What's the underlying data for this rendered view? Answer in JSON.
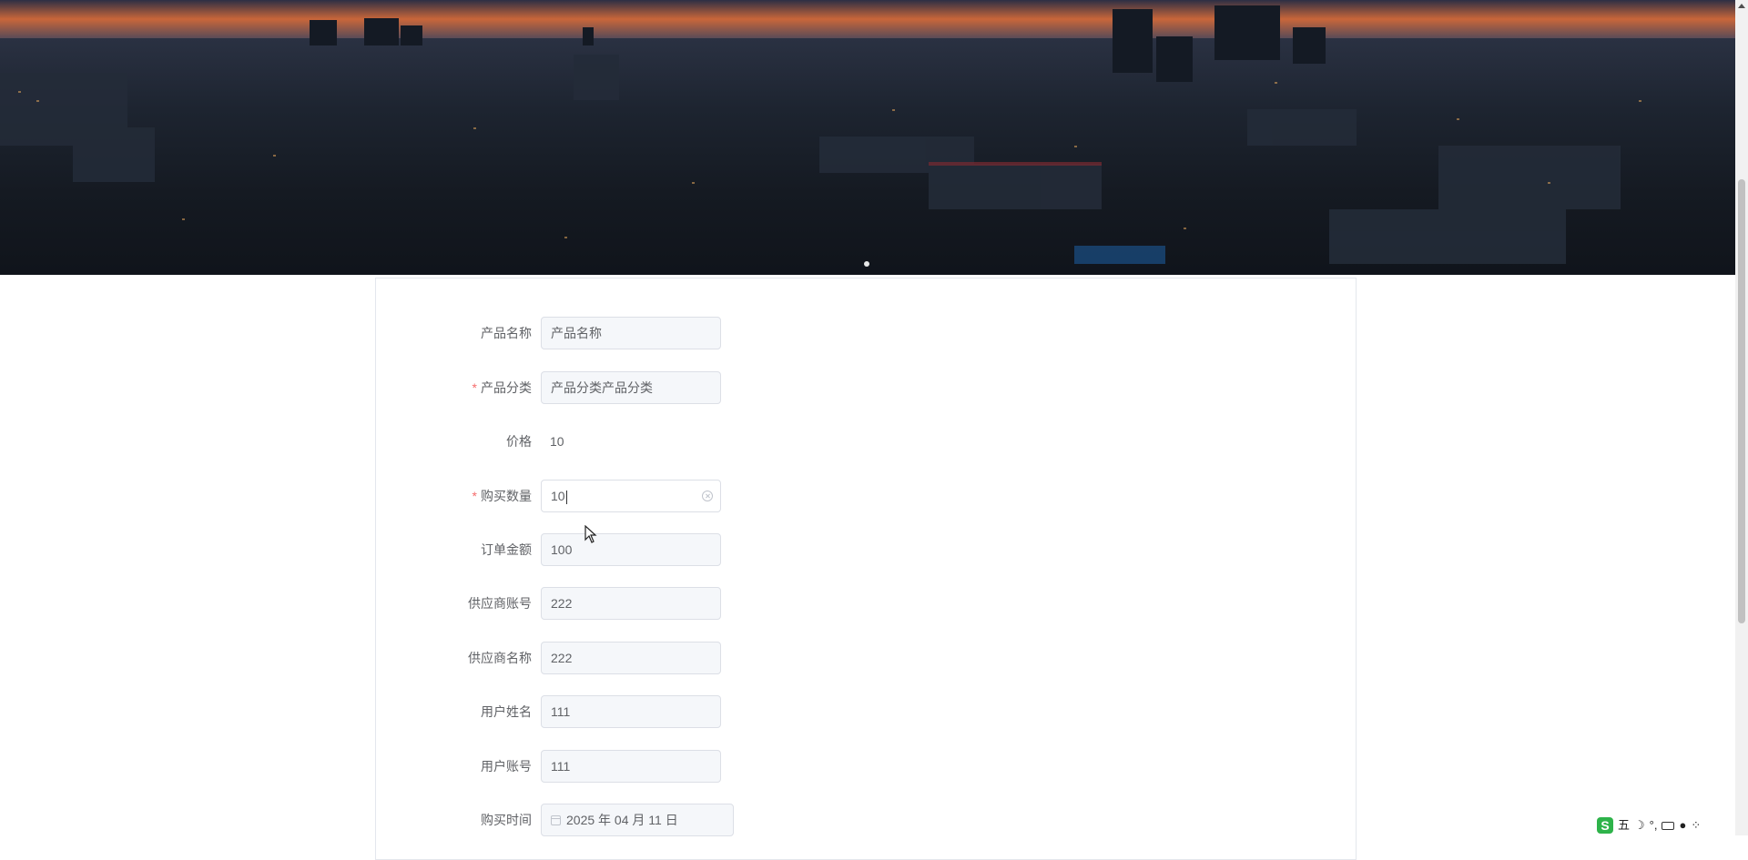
{
  "banner": {
    "image_alt": "city-skyline-at-dusk",
    "slide_count": 1,
    "active_slide": 1
  },
  "form": {
    "fields": [
      {
        "label": "产品名称",
        "value": "产品名称",
        "required": false,
        "kind": "input-disabled"
      },
      {
        "label": "产品分类",
        "value": "产品分类产品分类",
        "required": true,
        "kind": "input-disabled"
      },
      {
        "label": "价格",
        "value": "10",
        "required": false,
        "kind": "text"
      },
      {
        "label": "购买数量",
        "value": "10",
        "required": true,
        "kind": "input-active"
      },
      {
        "label": "订单金额",
        "value": "100",
        "required": false,
        "kind": "input-disabled"
      },
      {
        "label": "供应商账号",
        "value": "222",
        "required": false,
        "kind": "input-disabled"
      },
      {
        "label": "供应商名称",
        "value": "222",
        "required": false,
        "kind": "input-disabled"
      },
      {
        "label": "用户姓名",
        "value": "111",
        "required": false,
        "kind": "input-disabled"
      },
      {
        "label": "用户账号",
        "value": "111",
        "required": false,
        "kind": "input-disabled"
      },
      {
        "label": "购买时间",
        "value": "2025 年 04 月 11 日",
        "required": false,
        "kind": "date"
      }
    ],
    "required_mark": "*"
  },
  "tray": {
    "ime_logo": "S",
    "ime_mode": "五",
    "icons": [
      "moon-icon",
      "punctuation-icon",
      "keyboard-icon",
      "user-icon",
      "grid-icon"
    ]
  },
  "colors": {
    "border": "#dcdfe6",
    "disabled_bg": "#f5f7fa",
    "required": "#f56c6c",
    "label": "#606266"
  }
}
